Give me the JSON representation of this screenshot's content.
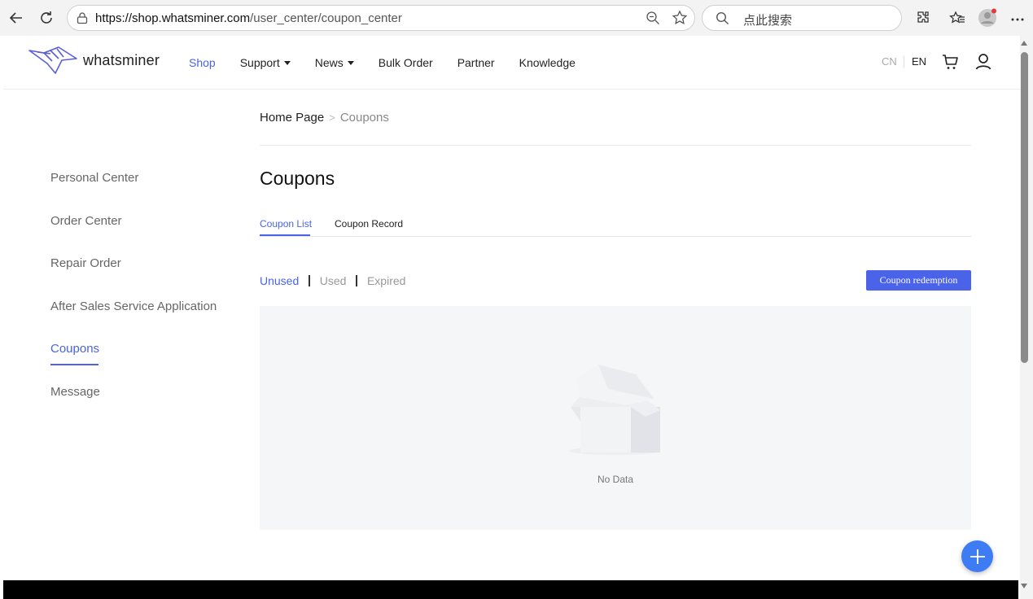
{
  "browser": {
    "url_host": "https://shop.whatsminer.com",
    "url_path": "/user_center/coupon_center",
    "search_placeholder": "点此搜索"
  },
  "header": {
    "logo_text": "whatsminer",
    "nav": [
      {
        "label": "Shop",
        "active": true
      },
      {
        "label": "Support",
        "dropdown": true
      },
      {
        "label": "News",
        "dropdown": true
      },
      {
        "label": "Bulk Order"
      },
      {
        "label": "Partner"
      },
      {
        "label": "Knowledge"
      }
    ],
    "lang_cn": "CN",
    "lang_en": "EN"
  },
  "sidebar": {
    "items": [
      {
        "label": "Personal Center"
      },
      {
        "label": "Order Center"
      },
      {
        "label": "Repair Order"
      },
      {
        "label": "After Sales Service Application"
      },
      {
        "label": "Coupons",
        "active": true
      },
      {
        "label": "Message"
      }
    ]
  },
  "breadcrumb": {
    "home": "Home Page",
    "separator": ">",
    "current": "Coupons"
  },
  "main": {
    "title": "Coupons",
    "tabs": [
      {
        "label": "Coupon List",
        "active": true
      },
      {
        "label": "Coupon Record"
      }
    ],
    "filters": [
      {
        "label": "Unused",
        "active": true
      },
      {
        "label": "Used"
      },
      {
        "label": "Expired"
      }
    ],
    "redeem_label": "Coupon redemption",
    "empty_text": "No Data"
  },
  "colors": {
    "accent": "#4a63e8",
    "fab": "#3d7cf2"
  }
}
